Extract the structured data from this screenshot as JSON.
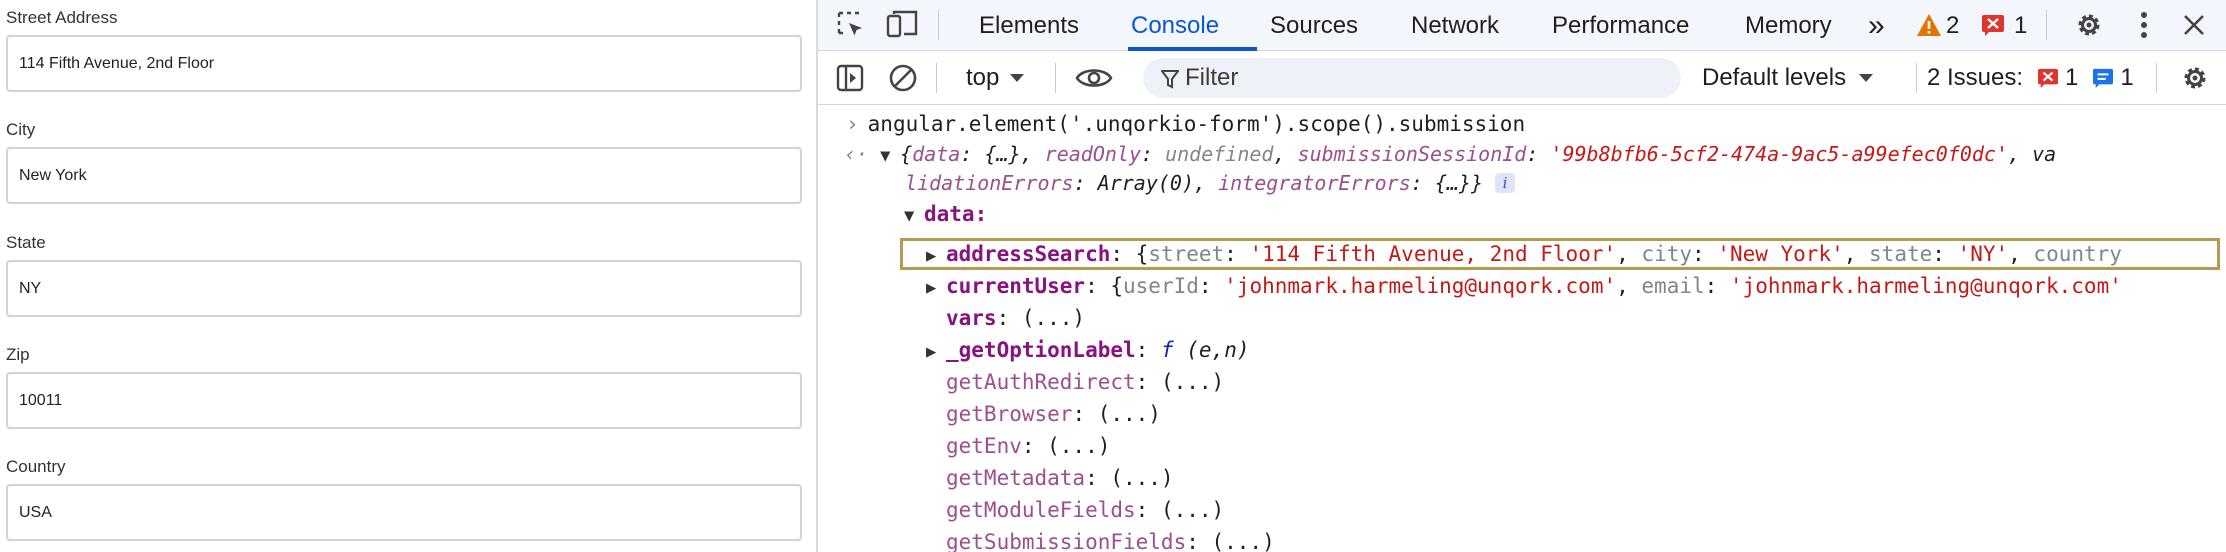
{
  "form": {
    "fields": [
      {
        "label": "Street Address",
        "value": "114 Fifth Avenue, 2nd Floor"
      },
      {
        "label": "City",
        "value": "New York"
      },
      {
        "label": "State",
        "value": "NY"
      },
      {
        "label": "Zip",
        "value": "10011"
      },
      {
        "label": "Country",
        "value": "USA"
      }
    ]
  },
  "devtools": {
    "tabs": [
      "Elements",
      "Console",
      "Sources",
      "Network",
      "Performance",
      "Memory"
    ],
    "active_tab": "Console",
    "more_tabs_glyph": "»",
    "warnings_count": "2",
    "errors_count": "1",
    "toolbar": {
      "context": "top",
      "filter_placeholder": "Filter",
      "levels": "Default levels",
      "issues_label": "2 Issues:",
      "issues_errors": "1",
      "issues_info": "1"
    },
    "colors": {
      "accent": "#0b57d0",
      "warning": "#e37400",
      "error": "#dc362e",
      "info": "#1a73e8",
      "highlight_border": "#b59a52"
    },
    "console": {
      "command": "angular.element('.unqorkio-form').scope().submission",
      "result_line1": {
        "p1": "{",
        "k_data": "data",
        "p2": ": {…}, ",
        "k_readonly": "readOnly",
        "p3": ": ",
        "v_undefined": "undefined",
        "p4": ", ",
        "k_session": "submissionSessionId",
        "p5": ": ",
        "v_session": "'99b8bfb6-5cf2-474a-9ac5-a99efec0f0dc'",
        "p6": ", va"
      },
      "result_line2": {
        "k_valerrors": "lidationErrors",
        "p1": ": Array(0), ",
        "k_integrator": "integratorErrors",
        "p2": ": {…}}"
      },
      "info_badge": "i",
      "data_key": "data:",
      "address": {
        "key": "addressSearch",
        "p1": ": {",
        "k_street": "street",
        "v_street": "'114 Fifth Avenue, 2nd Floor'",
        "k_city": "city",
        "v_city": "'New York'",
        "k_state": "state",
        "v_state": "'NY'",
        "k_country": "country"
      },
      "current_user": {
        "key": "currentUser",
        "k_userid": "userId",
        "v_userid": "'johnmark.harmeling@unqork.com'",
        "k_email": "email",
        "v_email": "'johnmark.harmeling@unqork.com'"
      },
      "vars_key": "vars",
      "getter_suffix": ": (...)",
      "option_label": {
        "key": "_getOptionLabel",
        "f": "f",
        "args": "(e,n)"
      },
      "getters": [
        "getAuthRedirect",
        "getBrowser",
        "getEnv",
        "getMetadata",
        "getModuleFields",
        "getSubmissionFields"
      ]
    }
  }
}
